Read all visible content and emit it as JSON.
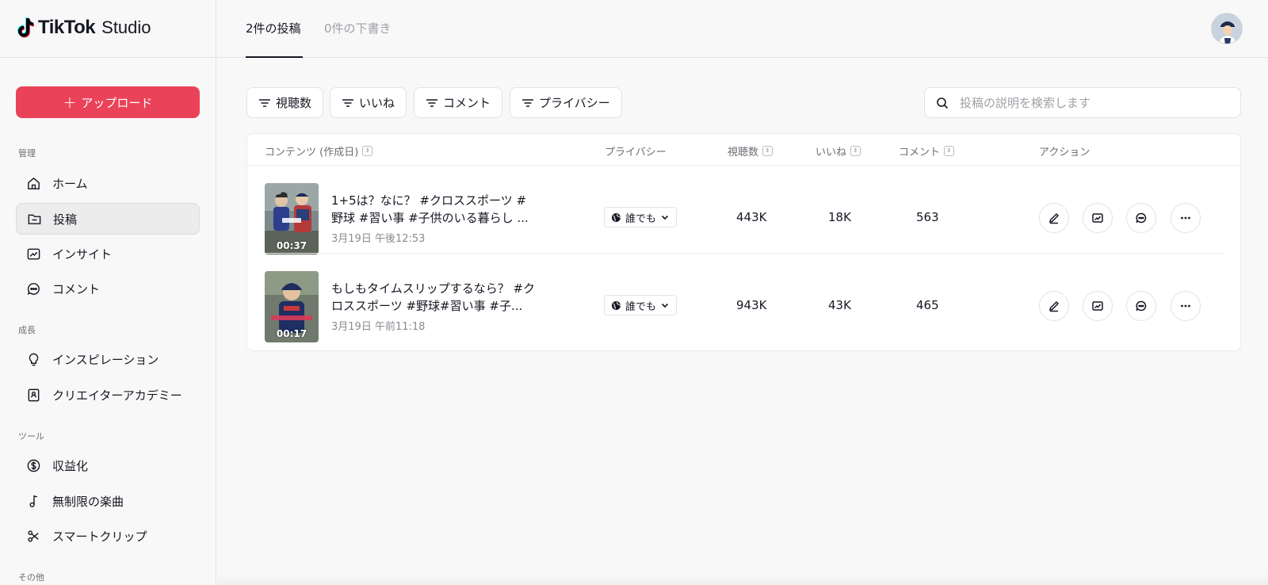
{
  "app": {
    "logo_text": "TikTok",
    "logo_suffix": "Studio"
  },
  "sidebar": {
    "upload_label": "アップロード",
    "sections": {
      "manage": "管理",
      "growth": "成長",
      "tools": "ツール",
      "other": "その他"
    },
    "items": {
      "home": "ホーム",
      "posts": "投稿",
      "insights": "インサイト",
      "comments": "コメント",
      "inspiration": "インスピレーション",
      "academy": "クリエイターアカデミー",
      "monetization": "収益化",
      "music": "無制限の楽曲",
      "smartclip": "スマートクリップ"
    }
  },
  "header": {
    "tab_posts": "2件の投稿",
    "tab_drafts": "0件の下書き"
  },
  "filters": {
    "views": "視聴数",
    "likes": "いいね",
    "comments": "コメント",
    "privacy": "プライバシー"
  },
  "search": {
    "placeholder": "投稿の説明を検索します"
  },
  "table": {
    "headers": {
      "content": "コンテンツ (作成日)",
      "privacy": "プライバシー",
      "views": "視聴数",
      "likes": "いいね",
      "comments": "コメント",
      "actions": "アクション"
    },
    "rows": [
      {
        "title": "1+5は？なに？ #クロススポーツ #野球 #習い事 #子供のいる暮らし ...",
        "date": "3月19日 午後12:53",
        "duration": "00:37",
        "privacy": "誰でも",
        "views": "443K",
        "likes": "18K",
        "comments": "563"
      },
      {
        "title": "もしもタイムスリップするなら？ #クロススポーツ #野球#習い事 #子...",
        "date": "3月19日 午前11:18",
        "duration": "00:17",
        "privacy": "誰でも",
        "views": "943K",
        "likes": "43K",
        "comments": "465"
      }
    ]
  },
  "colors": {
    "accent": "#ea4359",
    "text": "#161823",
    "muted": "#a0a1a7"
  }
}
